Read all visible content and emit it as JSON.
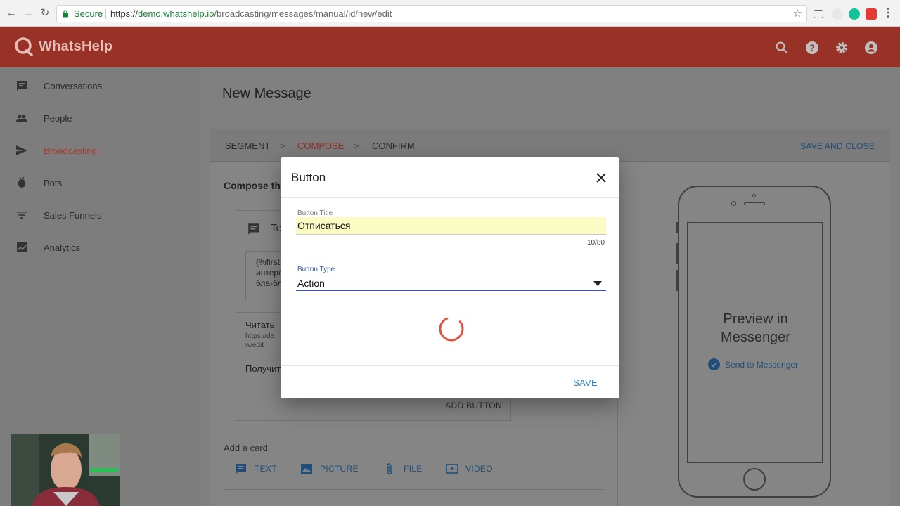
{
  "browser": {
    "secure_label": "Secure",
    "url_scheme": "https://",
    "url_host": "demo.whatshelp.io",
    "url_path": "/broadcasting/messages/manual/id/new/edit"
  },
  "app": {
    "logo_text": "WhatsHelp"
  },
  "sidebar": {
    "items": [
      {
        "label": "Conversations",
        "icon": "chat-icon"
      },
      {
        "label": "People",
        "icon": "people-icon"
      },
      {
        "label": "Broadcasting",
        "icon": "send-icon",
        "active": true
      },
      {
        "label": "Bots",
        "icon": "bot-icon"
      },
      {
        "label": "Sales Funnels",
        "icon": "filter-icon"
      },
      {
        "label": "Analytics",
        "icon": "analytics-icon"
      }
    ]
  },
  "page": {
    "title": "New Message"
  },
  "steps": {
    "segment": "SEGMENT",
    "compose": "COMPOSE",
    "confirm": "CONFIRM",
    "sep": ">",
    "save_and_close": "SAVE AND CLOSE"
  },
  "compose": {
    "title": "Compose th",
    "card_label": "Te",
    "text_content": "{%first\nинтере\nбла-бл",
    "button1_title": "Читать",
    "button1_sub": "https://de\nw/edit",
    "button2_title": "Получит",
    "add_button": "ADD BUTTON",
    "add_card_label": "Add a card",
    "card_types": [
      "TEXT",
      "PICTURE",
      "FILE",
      "VIDEO"
    ]
  },
  "preview": {
    "title": "Preview in Messenger",
    "send_label": "Send to Messenger"
  },
  "dialog": {
    "title": "Button",
    "button_title_label": "Button Title",
    "button_title_value": "Отписаться",
    "counter": "10/80",
    "button_type_label": "Button Type",
    "button_type_value": "Action",
    "save": "SAVE"
  },
  "colors": {
    "brand": "#d44637",
    "accent_blue": "#2a7fc6",
    "select_underline": "#3f51b5",
    "input_highlight": "#fbfcc4"
  }
}
